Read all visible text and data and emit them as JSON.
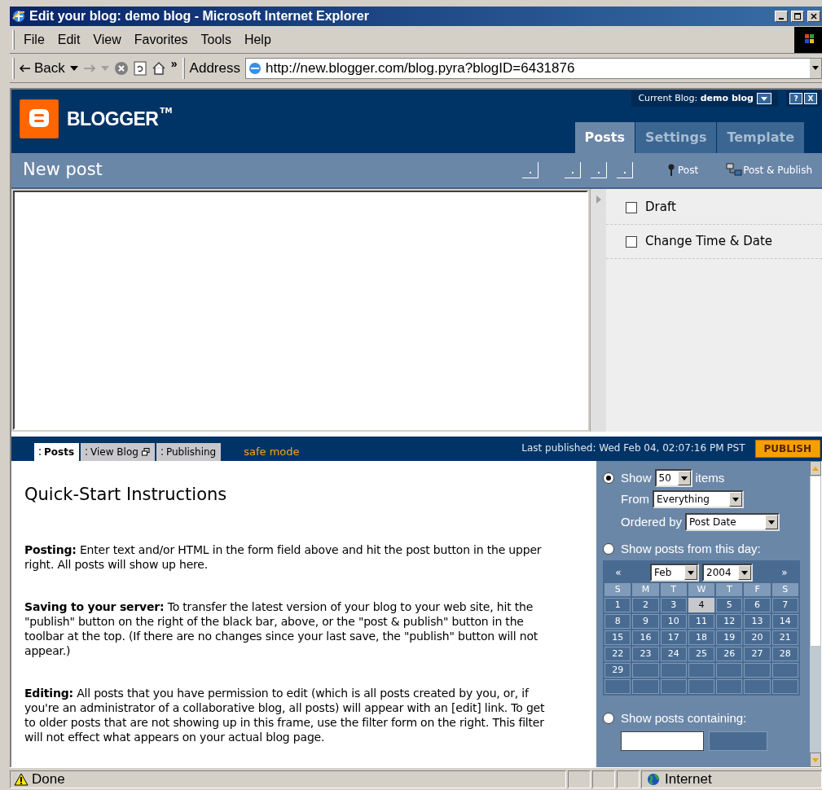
{
  "window": {
    "title": "Edit your blog: demo blog - Microsoft Internet Explorer"
  },
  "menu": [
    "File",
    "Edit",
    "View",
    "Favorites",
    "Tools",
    "Help"
  ],
  "toolbar": {
    "back": "Back",
    "chevron": "»",
    "address_label": "Address",
    "url": "http://new.blogger.com/blog.pyra?blogID=6431876"
  },
  "header": {
    "logo": "BLOGGER",
    "trademark": "TM",
    "current_blog_label": "Current Blog:",
    "current_blog": "demo blog",
    "help": "?",
    "close": "X",
    "tabs": [
      {
        "label": "Posts",
        "selected": true
      },
      {
        "label": "Settings",
        "selected": false
      },
      {
        "label": "Template",
        "selected": false
      }
    ]
  },
  "post_bar": {
    "title": "New post",
    "post": "Post",
    "post_publish": "Post & Publish"
  },
  "options": [
    {
      "label": "Draft",
      "checked": false
    },
    {
      "label": "Change Time & Date",
      "checked": false
    }
  ],
  "lower_bar": {
    "tabs": [
      {
        "label": "Posts",
        "selected": true
      },
      {
        "label": "View Blog",
        "selected": false
      },
      {
        "label": "Publishing",
        "selected": false
      }
    ],
    "safe_mode": "safe mode",
    "last_published": "Last published: Wed Feb 04, 02:07:16 PM PST",
    "publish": "PUBLISH"
  },
  "instructions": {
    "title": "Quick-Start Instructions",
    "paragraphs": [
      "**Posting:** Enter text and/or HTML in the form field above and hit the post button in the upper right. All posts will show up here.",
      "**Saving to your server:** To transfer the latest version of your blog to your web site, hit the \"publish\" button on the right of the black bar, above, or the \"post & publish\" button in the toolbar at the top. (If there are no changes since your last save, the \"publish\" button will not appear.)",
      "**Editing:** All posts that you have permission to edit (which is all posts created by you, or, if you're an administrator of a collaborative blog, all posts) will appear with an [edit] link. To get to older posts that are not showing up in this frame, use the filter form on the right. This filter will not effect what appears on your actual blog page."
    ]
  },
  "filter": {
    "show": {
      "selected": true,
      "label": "Show",
      "count": "50",
      "suffix": "items"
    },
    "from_label": "From",
    "from": "Everything",
    "order_label": "Ordered by",
    "order": "Post Date",
    "day": {
      "selected": false,
      "label": "Show posts from this day:"
    },
    "calendar": {
      "prev": "«",
      "next": "»",
      "month": "Feb",
      "year": "2004",
      "weekdays": [
        "S",
        "M",
        "T",
        "W",
        "T",
        "F",
        "S"
      ],
      "days": [
        {
          "label": "1",
          "selected": false
        },
        {
          "label": "2",
          "selected": false
        },
        {
          "label": "3",
          "selected": false
        },
        {
          "label": "4",
          "selected": true
        },
        {
          "label": "5",
          "selected": false
        },
        {
          "label": "6",
          "selected": false
        },
        {
          "label": "7",
          "selected": false
        },
        {
          "label": "8",
          "selected": false
        },
        {
          "label": "9",
          "selected": false
        },
        {
          "label": "10",
          "selected": false
        },
        {
          "label": "11",
          "selected": false
        },
        {
          "label": "12",
          "selected": false
        },
        {
          "label": "13",
          "selected": false
        },
        {
          "label": "14",
          "selected": false
        },
        {
          "label": "15",
          "selected": false
        },
        {
          "label": "16",
          "selected": false
        },
        {
          "label": "17",
          "selected": false
        },
        {
          "label": "18",
          "selected": false
        },
        {
          "label": "19",
          "selected": false
        },
        {
          "label": "20",
          "selected": false
        },
        {
          "label": "21",
          "selected": false
        },
        {
          "label": "22",
          "selected": false
        },
        {
          "label": "23",
          "selected": false
        },
        {
          "label": "24",
          "selected": false
        },
        {
          "label": "25",
          "selected": false
        },
        {
          "label": "26",
          "selected": false
        },
        {
          "label": "27",
          "selected": false
        },
        {
          "label": "28",
          "selected": false
        },
        {
          "label": "29",
          "selected": false
        }
      ]
    },
    "containing": {
      "selected": false,
      "label": "Show posts containing:"
    }
  },
  "status_bar": {
    "text": "Done",
    "zone": "Internet"
  }
}
